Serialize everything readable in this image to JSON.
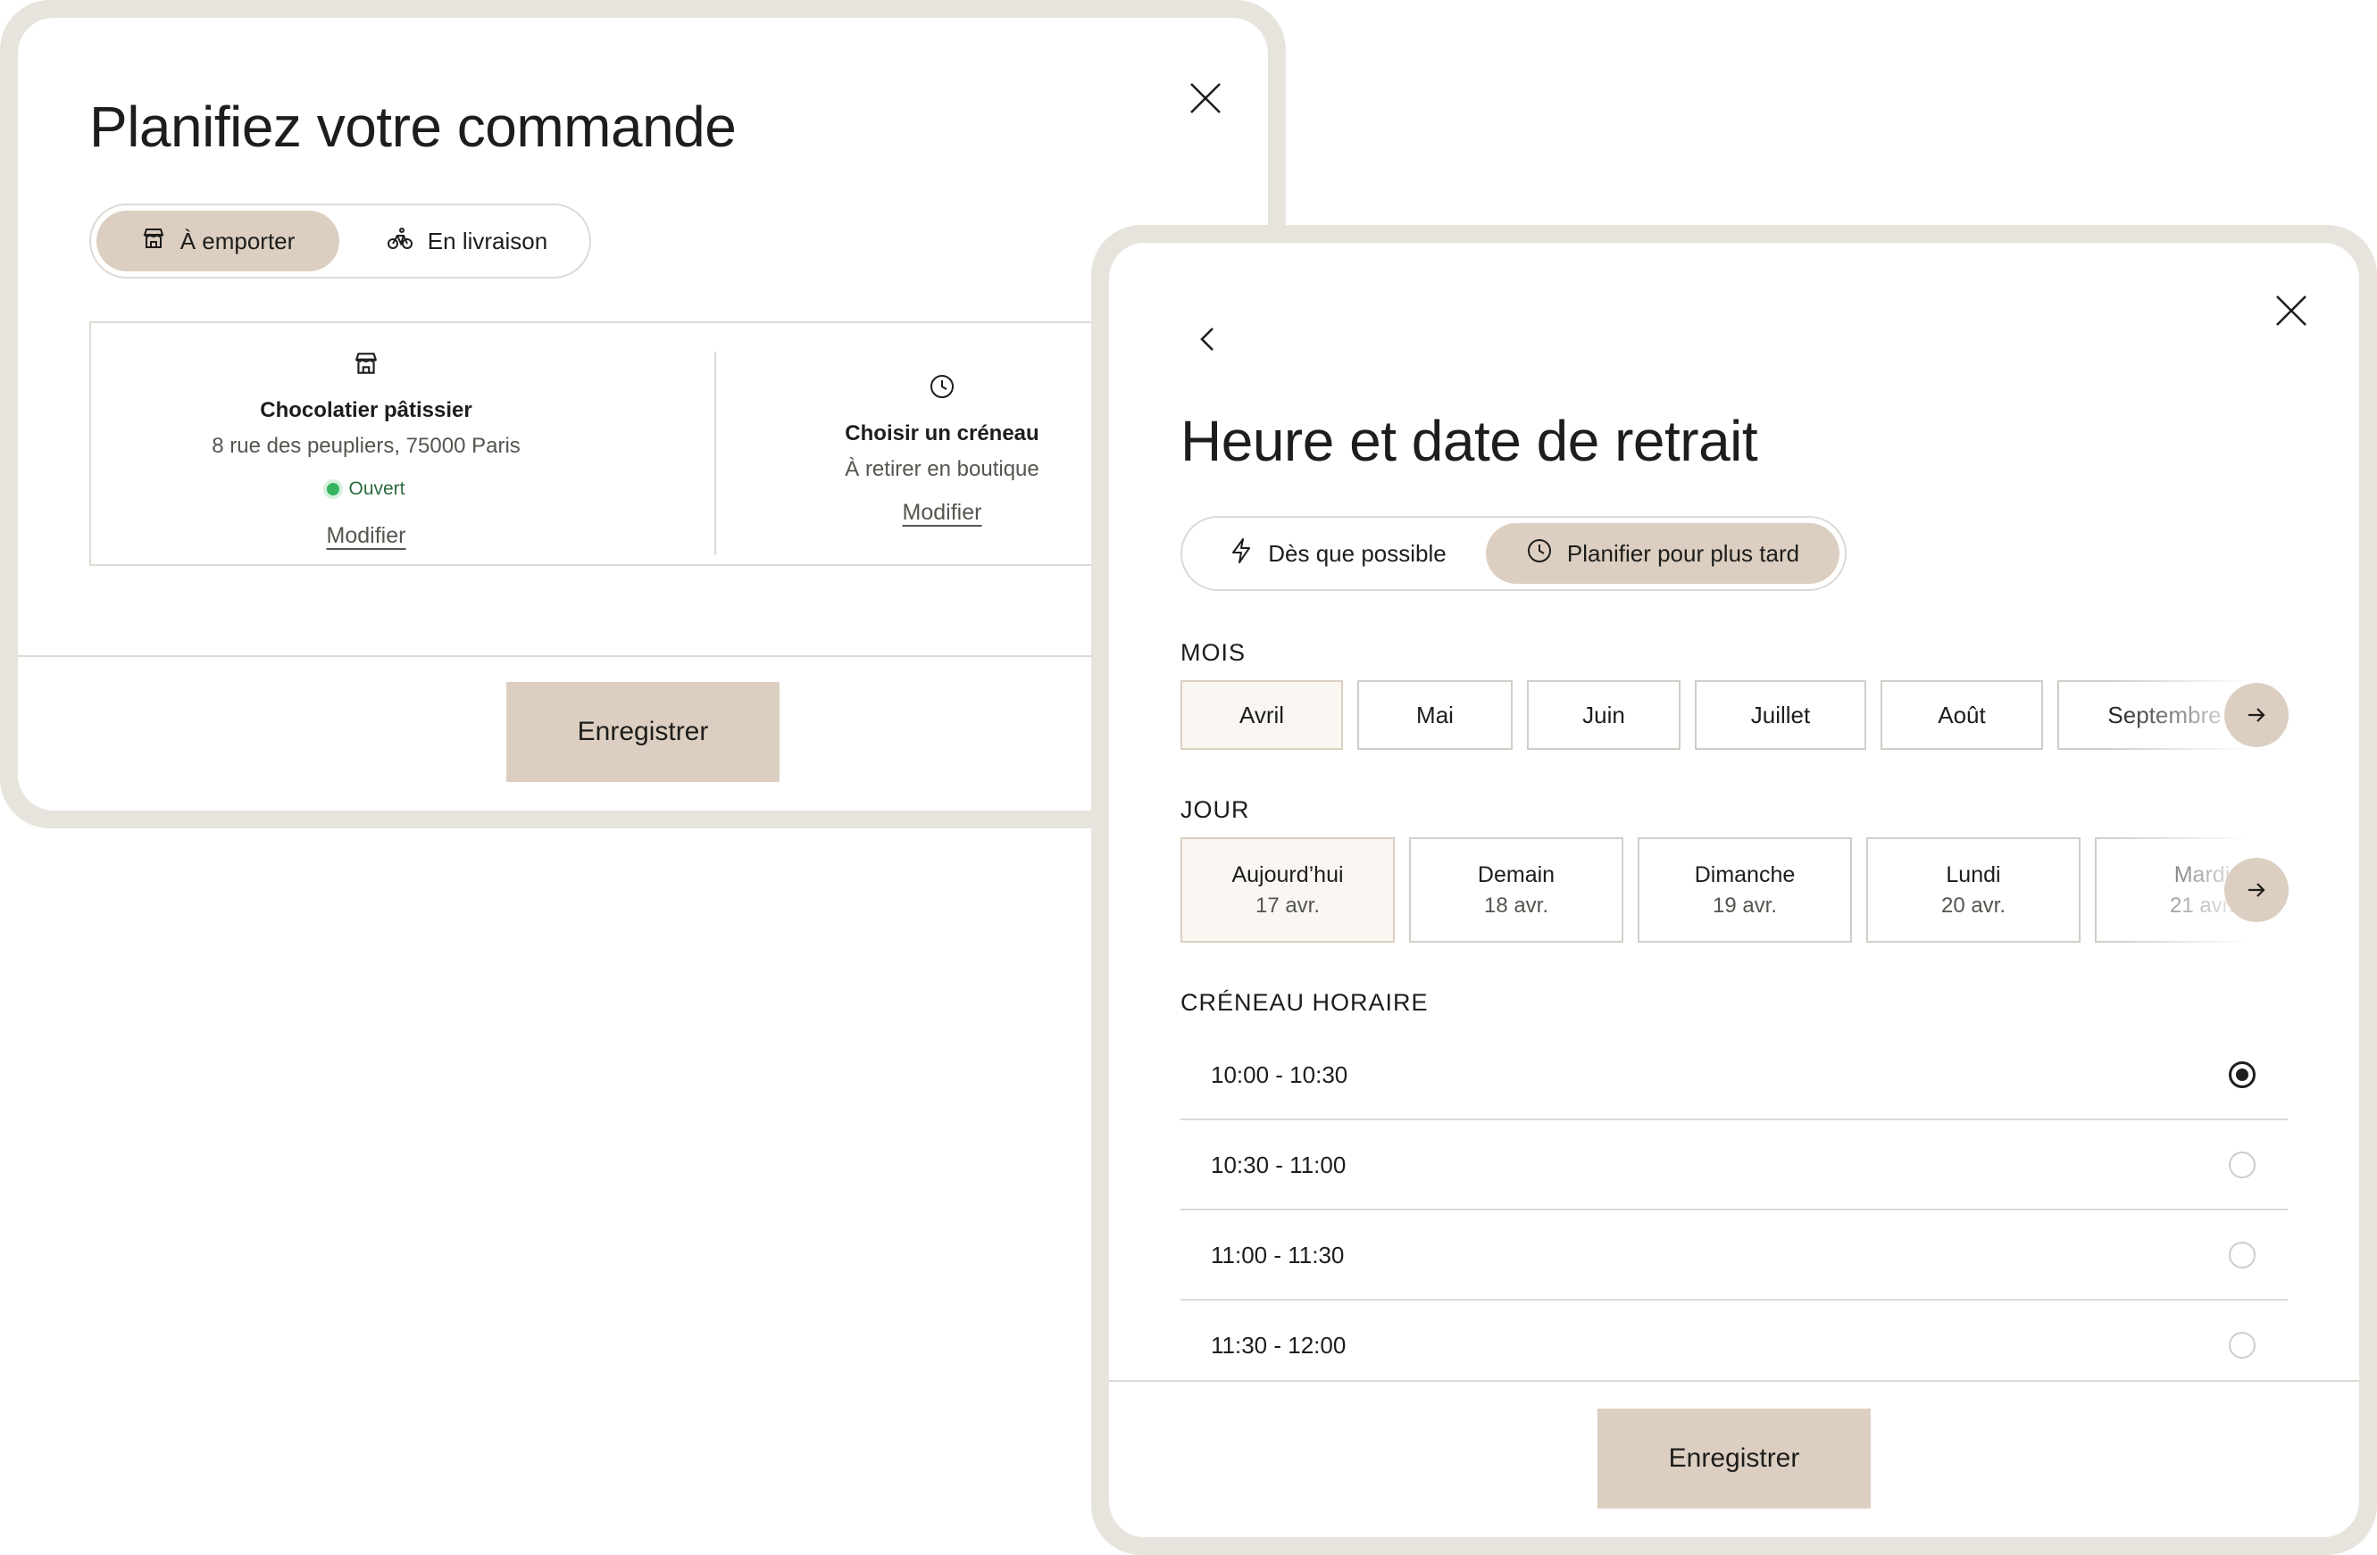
{
  "colors": {
    "frame": "#e6e4dc",
    "accent": "#dccfc1",
    "selected_chip_bg": "#faf7f2",
    "border": "#dcdad3",
    "open_status": "#36b360",
    "text": "#1d1d1b"
  },
  "modal_order": {
    "title": "Planifiez votre commande",
    "close_icon": "close-icon",
    "mode_toggle": {
      "options": [
        {
          "label": "À emporter",
          "icon": "store-icon",
          "selected": true
        },
        {
          "label": "En livraison",
          "icon": "bike-icon",
          "selected": false
        }
      ]
    },
    "store": {
      "icon": "store-icon",
      "name": "Chocolatier pâtissier",
      "address": "8 rue des peupliers, 75000 Paris",
      "status": "Ouvert",
      "edit_label": "Modifier"
    },
    "timeslot": {
      "icon": "clock-icon",
      "title": "Choisir un créneau",
      "subtitle": "À retirer en boutique",
      "edit_label": "Modifier"
    },
    "save_label": "Enregistrer"
  },
  "modal_pickup": {
    "title": "Heure et date de retrait",
    "back_icon": "chevron-left-icon",
    "close_icon": "close-icon",
    "timing_toggle": {
      "options": [
        {
          "label": "Dès que possible",
          "icon": "lightning-icon",
          "selected": false
        },
        {
          "label": "Planifier pour plus tard",
          "icon": "clock-icon",
          "selected": true
        }
      ]
    },
    "month_label": "MOIS",
    "months": [
      {
        "label": "Avril",
        "selected": true
      },
      {
        "label": "Mai",
        "selected": false
      },
      {
        "label": "Juin",
        "selected": false
      },
      {
        "label": "Juillet",
        "selected": false
      },
      {
        "label": "Août",
        "selected": false
      },
      {
        "label": "Septembre",
        "selected": false
      }
    ],
    "day_label": "JOUR",
    "days": [
      {
        "name": "Aujourd’hui",
        "date": "17 avr.",
        "selected": true
      },
      {
        "name": "Demain",
        "date": "18 avr.",
        "selected": false
      },
      {
        "name": "Dimanche",
        "date": "19 avr.",
        "selected": false
      },
      {
        "name": "Lundi",
        "date": "20 avr.",
        "selected": false
      },
      {
        "name": "Mardi",
        "date": "21 avr.",
        "selected": false
      }
    ],
    "slot_label": "CRÉNEAU HORAIRE",
    "slots": [
      {
        "label": "10:00 - 10:30",
        "selected": true
      },
      {
        "label": "10:30 - 11:00",
        "selected": false
      },
      {
        "label": "11:00 - 11:30",
        "selected": false
      },
      {
        "label": "11:30 - 12:00",
        "selected": false
      }
    ],
    "save_label": "Enregistrer"
  }
}
